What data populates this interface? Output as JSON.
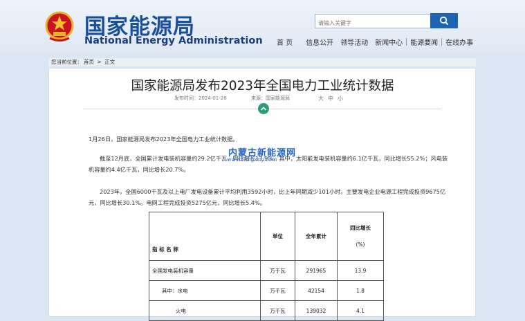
{
  "site": {
    "name_cn": "国家能源局",
    "name_en": "National Energy Administration"
  },
  "search": {
    "placeholder": "请输入关键字",
    "button_icon": "search-icon"
  },
  "nav": {
    "items": [
      "首 页",
      "信息公开",
      "领导活动",
      "新闻中心",
      "能源要闻",
      "在线办事"
    ]
  },
  "breadcrumb": {
    "prefix": "您当前位置：",
    "home": "首页",
    "sep": ">",
    "current": "正文"
  },
  "article": {
    "title": "国家能源局发布2023年全国电力工业统计数据",
    "date_label": "发布时间：2024-01-26",
    "source_label": "来源：国家能源局",
    "font_sizes": [
      "大",
      "中",
      "小"
    ],
    "paragraphs": [
      "1月26日，国家能源局发布2023年全国电力工业统计数据。",
      "截至12月底，全国累计发电装机容量约29.2亿千瓦，同比增长13.9%。其中，太阳能发电装机容量约6.1亿千瓦，同比增长55.2%；风电装机容量约4.4亿千瓦，同比增长20.7%。",
      "2023年，全国6000千瓦及以上电厂发电设备累计平均利用3592小时，比上年同期减少101小时。主要发电企业电源工程完成投资9675亿元，同比增长30.1%。电网工程完成投资5275亿元，同比增长5.4%。"
    ]
  },
  "watermark": {
    "line1": "内蒙古新能源网",
    "line2": "www.nmgxny.com"
  },
  "table": {
    "headers": [
      "指 标 名 称",
      "单位",
      "全年累计",
      "同比增长",
      "(%)"
    ],
    "rows": [
      {
        "name": "全国发电装机容量",
        "unit": "万千瓦",
        "total": "291965",
        "growth": "13.9"
      },
      {
        "name": "其中：水电",
        "unit": "万千瓦",
        "total": "42154",
        "growth": "1.8"
      },
      {
        "name": "火电",
        "unit": "万千瓦",
        "total": "139032",
        "growth": "4.1"
      }
    ]
  },
  "colors": {
    "brand_blue": "#1a4f9c",
    "accent_green": "#2c9a7c"
  }
}
